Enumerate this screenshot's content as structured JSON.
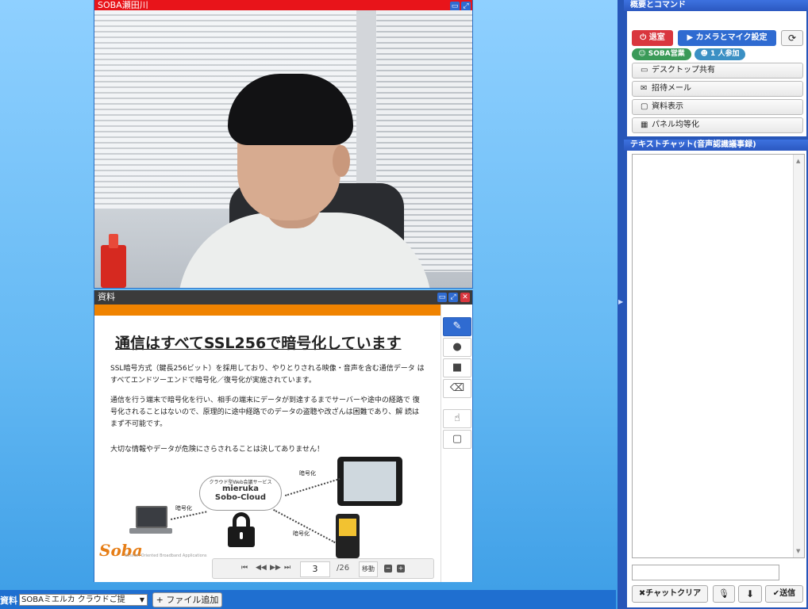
{
  "video_panel": {
    "title": "SOBA瀬田川",
    "header_color": "#e8141a"
  },
  "doc_panel": {
    "title": "資料",
    "slide": {
      "title": "通信はすべてSSL256で暗号化しています",
      "para1": "SSL暗号方式（鍵長256ビット）を採用しており、やりとりされる映像・音声を含む通信データ はすべてエンドツーエンドで暗号化／復号化が実施されています。",
      "para2": "通信を行う端末で暗号化を行い、相手の端末にデータが到達するまでサーバーや途中の経路で 復号化されることはないので、原理的に途中経路でのデータの盗聴や改ざんは困難であり、解 読はまず不可能です。",
      "para3": "大切な情報やデータが危険にさらされることは決してありません！",
      "cloud_sub": "クラウド型Web会議サービス",
      "cloud_brand": "mieruka",
      "cloud_brand2": "Sobo-Cloud",
      "enc_label": "暗号化",
      "logo_text": "Soba",
      "logo_sub": "Session Oriented Broadband Applications"
    },
    "pager": {
      "page": "3",
      "total": "/26",
      "move_label": "移動"
    },
    "accent_color": "#f08300"
  },
  "bottom_bar": {
    "label": "資料",
    "select_value": "SOBAミエルカ クラウドご提",
    "add_file_label": "+ ファイル追加"
  },
  "sidebar": {
    "overview_title": "概要とコマンド",
    "leave_label": "退室",
    "camera_mic_label": "カメラとマイク設定",
    "tag_group": "SOBA営業",
    "tag_participants": "1 人参加",
    "commands": [
      {
        "icon": "monitor-icon",
        "label": "デスクトップ共有"
      },
      {
        "icon": "envelope-icon",
        "label": "招待メール"
      },
      {
        "icon": "document-icon",
        "label": "資料表示"
      },
      {
        "icon": "grid-icon",
        "label": "パネル均等化"
      }
    ],
    "chat_title": "テキストチャット(音声認識議事録)",
    "chat_clear_label": "チャットクリア",
    "send_label": "送信"
  }
}
